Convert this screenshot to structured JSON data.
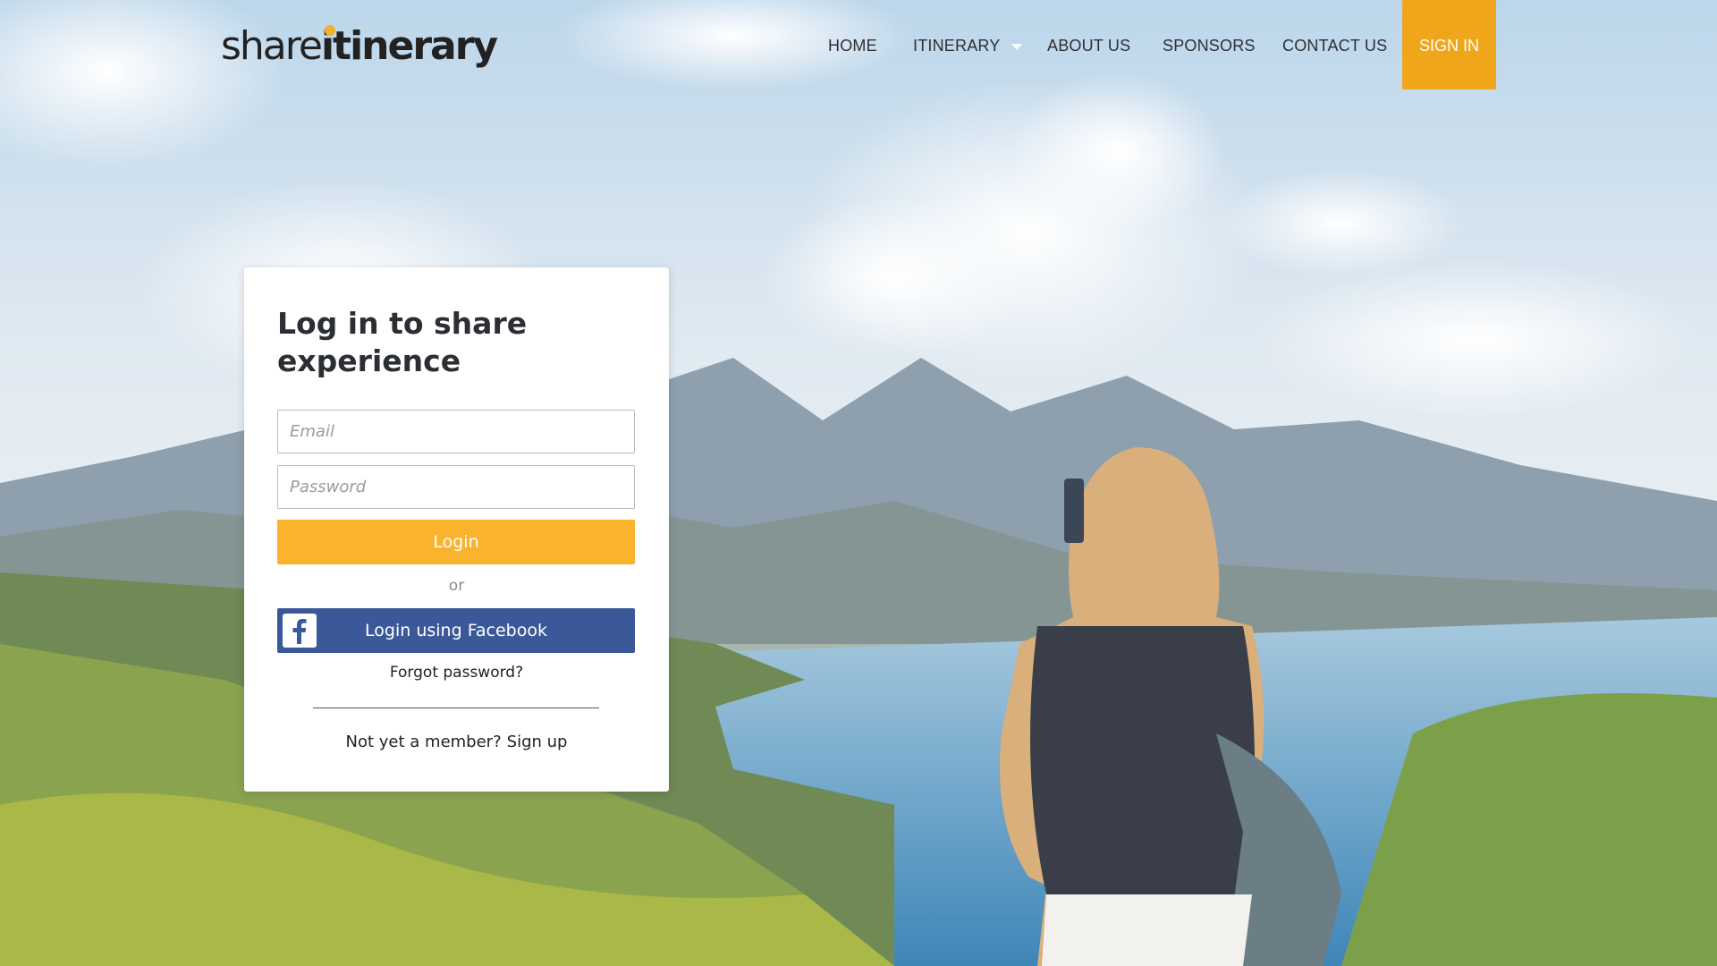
{
  "brand": {
    "logo_light": "share",
    "logo_bold": "itinerary",
    "accent": "#f0a61a"
  },
  "nav": {
    "items": [
      "HOME",
      "ITINERARY",
      "ABOUT US",
      "SPONSORS",
      "CONTACT US"
    ],
    "signin": "SIGN IN"
  },
  "login": {
    "title": "Log in to share experience",
    "email_placeholder": "Email",
    "password_placeholder": "Password",
    "login_button": "Login",
    "or": "or",
    "facebook_button": "Login using Facebook",
    "forgot": "Forgot password?",
    "not_member": "Not yet a member?",
    "signup": "Sign up"
  },
  "colors": {
    "login_button": "#f9b32c",
    "facebook": "#3b5998"
  }
}
